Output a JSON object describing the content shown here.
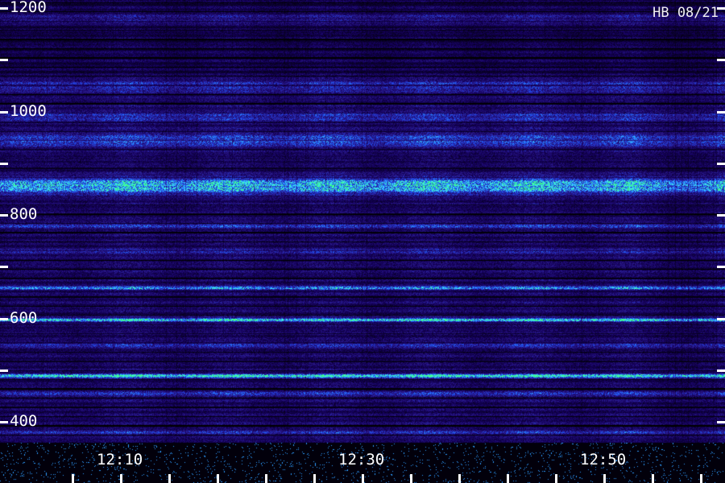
{
  "stamp": "HB 08/21",
  "chart_data": {
    "type": "heatmap",
    "title": "",
    "xlabel": "",
    "ylabel": "",
    "y_range": [
      360,
      1200
    ],
    "x_range": [
      "12:01",
      "12:59"
    ],
    "y_tick_labels": [
      "1200",
      "1000",
      "800",
      "600",
      "400"
    ],
    "y_tick_values": [
      1200,
      1000,
      800,
      600,
      400
    ],
    "y_minor_ticks": [
      1200,
      1100,
      1000,
      900,
      800,
      700,
      600,
      500,
      400
    ],
    "x_tick_labels": [
      "12:10",
      "12:30",
      "12:50"
    ],
    "x_tick_minutes": [
      10,
      30,
      50
    ],
    "x_minor_tick_minutes": [
      6,
      10,
      14,
      18,
      22,
      26,
      30,
      34,
      38,
      42,
      46,
      50,
      54,
      58
    ],
    "bands": [
      {
        "center": 1180,
        "width": 10,
        "intensity": 0.18
      },
      {
        "center": 1050,
        "width": 14,
        "intensity": 0.28
      },
      {
        "center": 990,
        "width": 10,
        "intensity": 0.24
      },
      {
        "center": 945,
        "width": 14,
        "intensity": 0.32
      },
      {
        "center": 857,
        "width": 14,
        "intensity": 0.72
      },
      {
        "center": 780,
        "width": 5,
        "intensity": 0.26
      },
      {
        "center": 730,
        "width": 4,
        "intensity": 0.24
      },
      {
        "center": 660,
        "width": 3,
        "intensity": 0.62
      },
      {
        "center": 598,
        "width": 3,
        "intensity": 0.85
      },
      {
        "center": 550,
        "width": 4,
        "intensity": 0.3
      },
      {
        "center": 490,
        "width": 3,
        "intensity": 1.0
      },
      {
        "center": 455,
        "width": 4,
        "intensity": 0.28
      },
      {
        "center": 380,
        "width": 4,
        "intensity": 0.25
      }
    ],
    "colormap": [
      "#000000",
      "#14005a",
      "#2a1a8c",
      "#1f3fe0",
      "#2a8cff",
      "#3fe8ff",
      "#3dff8a"
    ]
  }
}
